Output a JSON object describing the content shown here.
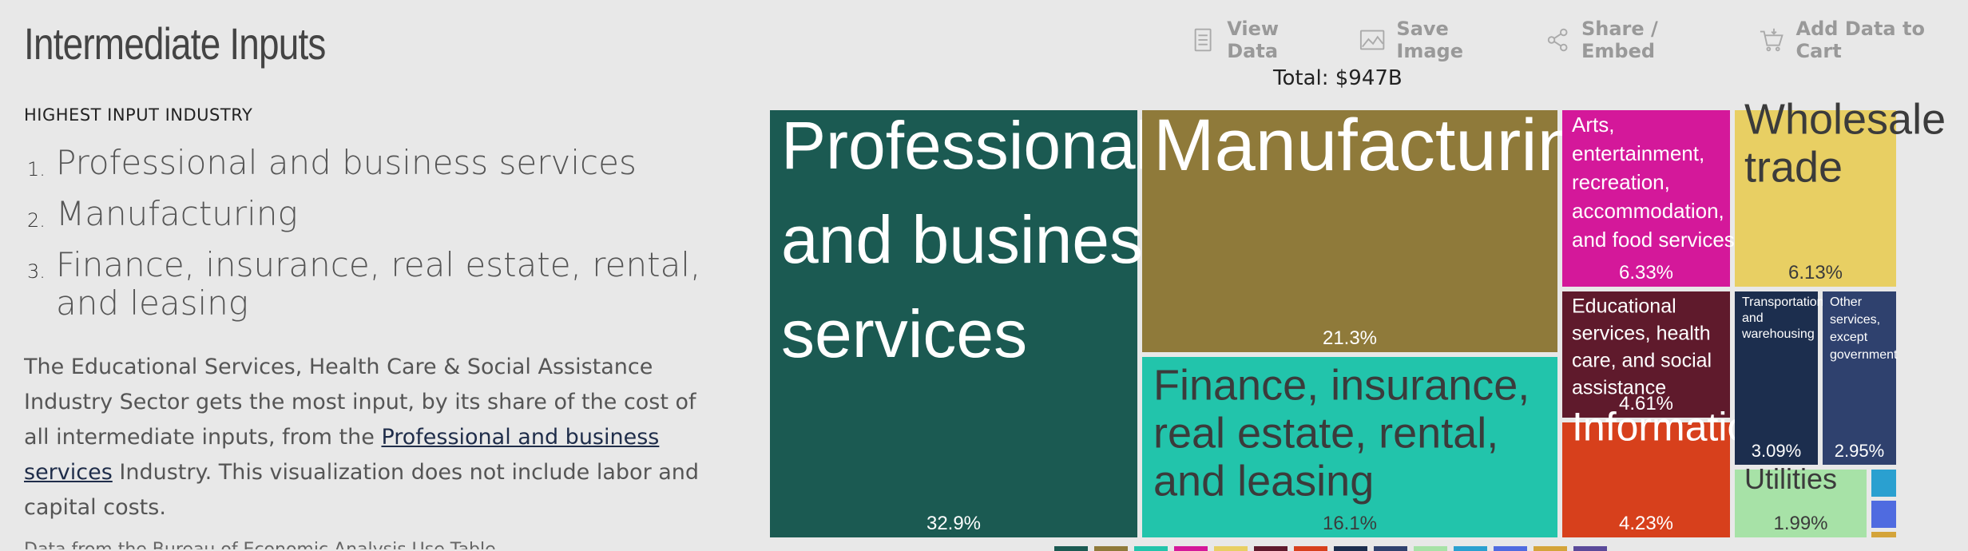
{
  "header": {
    "title": "Intermediate Inputs"
  },
  "ranking": {
    "heading": "HIGHEST INPUT INDUSTRY",
    "items": [
      {
        "num": "1.",
        "label": "Professional and business services"
      },
      {
        "num": "2.",
        "label": "Manufacturing"
      },
      {
        "num": "3.",
        "label": "Finance, insurance, real estate, rental, and leasing"
      }
    ]
  },
  "description": {
    "pre": "The Educational Services, Health Care & Social Assistance Industry Sector gets the most input, by its share of the cost of all intermediate inputs, from the ",
    "link": "Professional and business services",
    "post": " Industry. This visualization does not include labor and capital costs."
  },
  "source_note": "Data from the Bureau of Economic Analysis Use Table",
  "toolbar": {
    "view_data": "View Data",
    "save_image": "Save Image",
    "share_embed": "Share / Embed",
    "add_cart": "Add Data to Cart"
  },
  "total_label": "Total: $947B",
  "chart_data": {
    "type": "treemap",
    "total": "Total: $947B",
    "nodes": [
      {
        "label": "Professional and business services",
        "value": 32.9,
        "pct": "32.9%",
        "color": "#1b5a52",
        "text_color": "#ffffff"
      },
      {
        "label": "Manufacturing",
        "value": 21.3,
        "pct": "21.3%",
        "color": "#8f7a3a",
        "text_color": "#ffffff"
      },
      {
        "label": "Finance, insurance, real estate, rental, and leasing",
        "value": 16.1,
        "pct": "16.1%",
        "color": "#22c4ab",
        "text_color": "#3b3b3b"
      },
      {
        "label": "Arts, entertainment, recreation, accommodation, and food services",
        "value": 6.33,
        "pct": "6.33%",
        "color": "#d4189a",
        "text_color": "#ffffff"
      },
      {
        "label": "Wholesale trade",
        "value": 6.13,
        "pct": "6.13%",
        "color": "#e8cf63",
        "text_color": "#3b3b3b"
      },
      {
        "label": "Educational services, health care, and social assistance",
        "value": 4.61,
        "pct": "4.61%",
        "color": "#5f1a2c",
        "text_color": "#ffffff"
      },
      {
        "label": "Information",
        "value": 4.23,
        "pct": "4.23%",
        "color": "#d7401c",
        "text_color": "#ffffff"
      },
      {
        "label": "Transportation and warehousing",
        "value": 3.09,
        "pct": "3.09%",
        "color": "#1c2e4e",
        "text_color": "#ffffff"
      },
      {
        "label": "Other services, except government",
        "value": 2.95,
        "pct": "2.95%",
        "color": "#2f416e",
        "text_color": "#ffffff"
      },
      {
        "label": "Utilities",
        "value": 1.99,
        "pct": "1.99%",
        "color": "#a7e2a7",
        "text_color": "#3b3b3b"
      },
      {
        "label": "",
        "value": 0.2,
        "pct": "",
        "color": "#2aa0d0",
        "text_color": "#ffffff"
      },
      {
        "label": "",
        "value": 0.2,
        "pct": "",
        "color": "#4f6be0",
        "text_color": "#ffffff"
      },
      {
        "label": "",
        "value": 0.1,
        "pct": "",
        "color": "#d4a43a",
        "text_color": "#ffffff"
      }
    ],
    "legend_colors": [
      "#1b5a52",
      "#8f7a3a",
      "#22c4ab",
      "#d4189a",
      "#e8cf63",
      "#5f1a2c",
      "#d7401c",
      "#1c2e4e",
      "#2f416e",
      "#a7e2a7",
      "#2aa0d0",
      "#4f6be0",
      "#d4a43a",
      "#5a4a9a"
    ]
  }
}
